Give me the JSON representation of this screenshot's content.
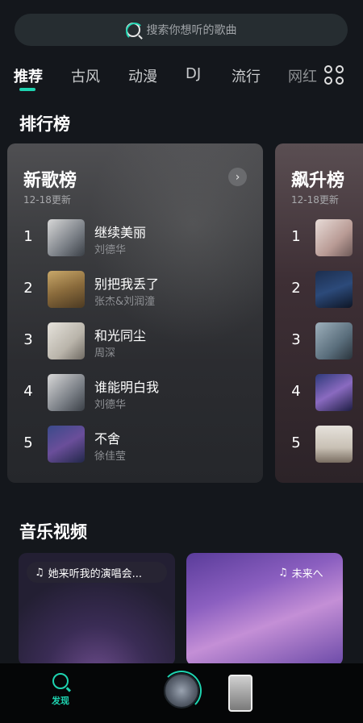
{
  "search": {
    "placeholder": "搜索你想听的歌曲"
  },
  "tabs": [
    {
      "label": "推荐",
      "active": true
    },
    {
      "label": "古风"
    },
    {
      "label": "动漫"
    },
    {
      "label": "DJ"
    },
    {
      "label": "流行"
    },
    {
      "label": "网红"
    }
  ],
  "charts_section": {
    "title": "排行榜"
  },
  "charts": [
    {
      "title": "新歌榜",
      "date": "12-18更新",
      "songs": [
        {
          "rank": "1",
          "name": "继续美丽",
          "artist": "刘德华"
        },
        {
          "rank": "2",
          "name": "别把我丢了",
          "artist": "张杰&刘润潼"
        },
        {
          "rank": "3",
          "name": "和光同尘",
          "artist": "周深"
        },
        {
          "rank": "4",
          "name": "谁能明白我",
          "artist": "刘德华"
        },
        {
          "rank": "5",
          "name": "不舍",
          "artist": "徐佳莹"
        }
      ]
    },
    {
      "title": "飙升榜",
      "date": "12-18更新",
      "songs": [
        {
          "rank": "1"
        },
        {
          "rank": "2"
        },
        {
          "rank": "3"
        },
        {
          "rank": "4"
        },
        {
          "rank": "5"
        }
      ]
    }
  ],
  "videos_section": {
    "title": "音乐视频"
  },
  "videos": [
    {
      "title": "她来听我的演唱会..."
    },
    {
      "title": "未来へ"
    }
  ],
  "bottom_nav": {
    "discover_label": "发现"
  },
  "colors": {
    "accent": "#1ed3b0",
    "background": "#14171c"
  }
}
